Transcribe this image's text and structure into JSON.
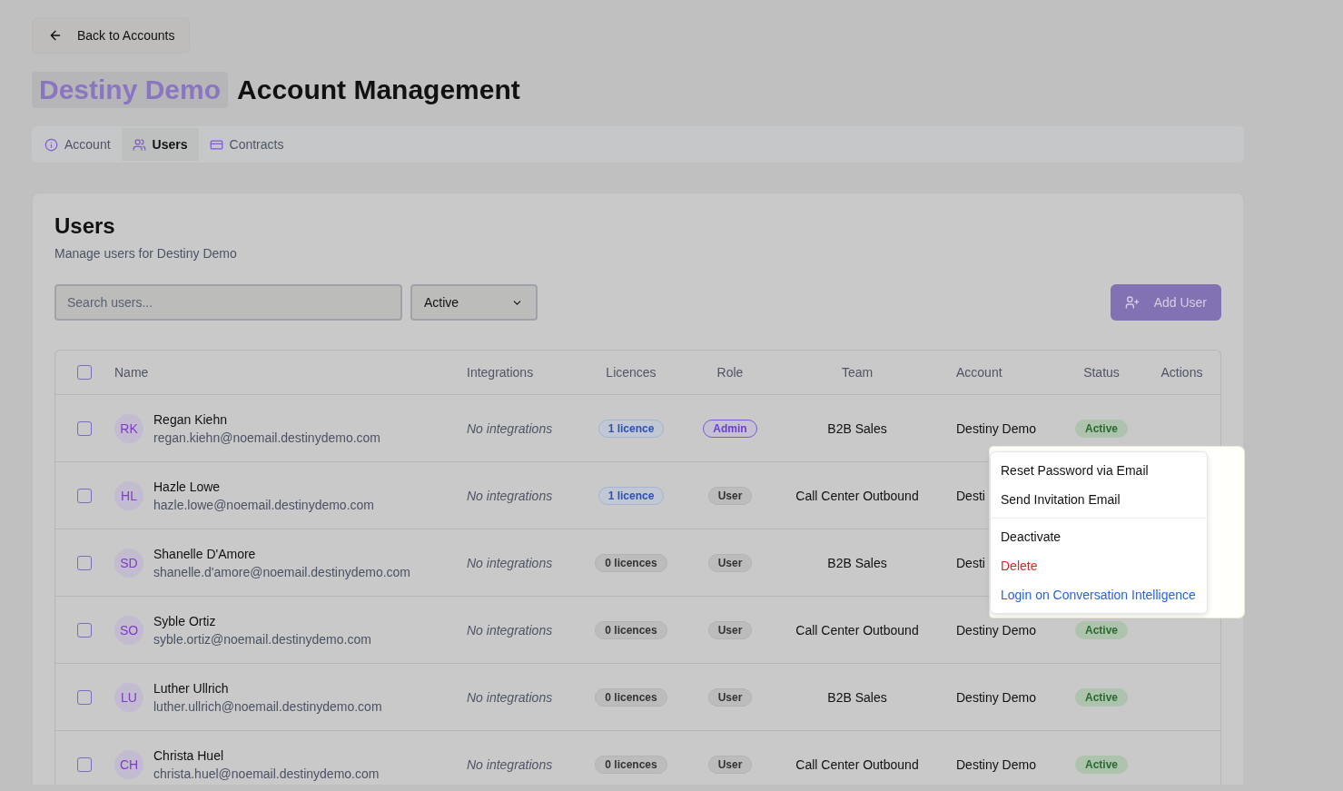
{
  "back_button": {
    "label": "Back to Accounts"
  },
  "title": {
    "account": "Destiny Demo",
    "text": "Account Management"
  },
  "tabs": [
    {
      "label": "Account",
      "kind": "info",
      "selected": false
    },
    {
      "label": "Users",
      "kind": "users",
      "selected": true
    },
    {
      "label": "Contracts",
      "kind": "card",
      "selected": false
    }
  ],
  "users_card": {
    "heading": "Users",
    "subtitle": "Manage users for Destiny Demo",
    "search": {
      "placeholder": "Search users..."
    },
    "status_filter": {
      "value": "Active"
    },
    "add_button": {
      "label": "Add User"
    },
    "table": {
      "select_all": {
        "checked": false
      },
      "columns": [
        "Name",
        "Integrations",
        "Licences",
        "Role",
        "Team",
        "Account",
        "Status",
        "Actions"
      ],
      "rows": [
        {
          "initials": "RK",
          "name": "Regan Kiehn",
          "email": "regan.kiehn@noemail.destinydemo.com",
          "integrations": "No integrations",
          "licences": {
            "label": "1 licence",
            "kind": "assigned"
          },
          "role": {
            "label": "Admin",
            "kind": "admin"
          },
          "team": "B2B Sales",
          "account": "Destiny Demo",
          "status": "Active",
          "checked": false
        },
        {
          "initials": "HL",
          "name": "Hazle Lowe",
          "email": "hazle.lowe@noemail.destinydemo.com",
          "integrations": "No integrations",
          "licences": {
            "label": "1 licence",
            "kind": "assigned"
          },
          "role": {
            "label": "User",
            "kind": "user"
          },
          "team": "Call Center Outbound",
          "account": "Desti",
          "checked": false
        },
        {
          "initials": "SD",
          "name": "Shanelle D'Amore",
          "email": "shanelle.d'amore@noemail.destinydemo.com",
          "integrations": "No integrations",
          "licences": {
            "label": "0 licences",
            "kind": "none"
          },
          "role": {
            "label": "User",
            "kind": "user"
          },
          "team": "B2B Sales",
          "account": "Desti",
          "checked": false
        },
        {
          "initials": "SO",
          "name": "Syble Ortiz",
          "email": "syble.ortiz@noemail.destinydemo.com",
          "integrations": "No integrations",
          "licences": {
            "label": "0 licences",
            "kind": "none"
          },
          "role": {
            "label": "User",
            "kind": "user"
          },
          "team": "Call Center Outbound",
          "account": "Destiny Demo",
          "status": "Active",
          "checked": false
        },
        {
          "initials": "LU",
          "name": "Luther Ullrich",
          "email": "luther.ullrich@noemail.destinydemo.com",
          "integrations": "No integrations",
          "licences": {
            "label": "0 licences",
            "kind": "none"
          },
          "role": {
            "label": "User",
            "kind": "user"
          },
          "team": "B2B Sales",
          "account": "Destiny Demo",
          "status": "Active",
          "checked": false
        },
        {
          "initials": "CH",
          "name": "Christa Huel",
          "email": "christa.huel@noemail.destinydemo.com",
          "integrations": "No integrations",
          "licences": {
            "label": "0 licences",
            "kind": "none"
          },
          "role": {
            "label": "User",
            "kind": "user"
          },
          "team": "Call Center Outbound",
          "account": "Destiny Demo",
          "status": "Active",
          "checked": false
        }
      ]
    }
  },
  "actions_menu": {
    "groups": [
      [
        {
          "label": "Reset Password via Email",
          "kind": "action"
        },
        {
          "label": "Send Invitation Email",
          "kind": "action"
        }
      ],
      [
        {
          "label": "Deactivate",
          "kind": "action"
        },
        {
          "label": "Delete",
          "kind": "danger"
        },
        {
          "label": "Login on Conversation Intelligence",
          "kind": "link"
        }
      ]
    ]
  }
}
